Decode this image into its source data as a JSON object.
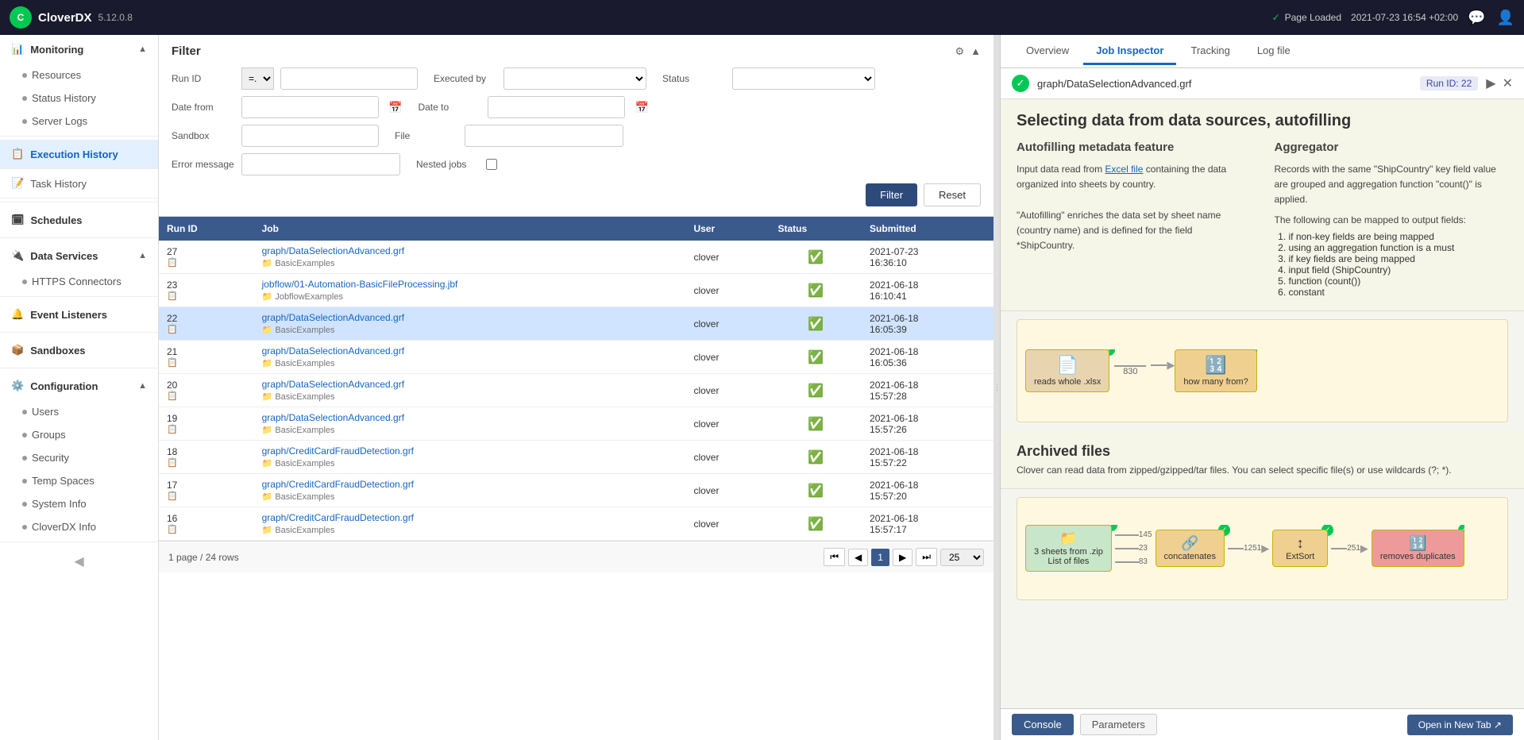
{
  "topnav": {
    "logo_text": "C",
    "brand": "CloverDX",
    "version": "5.12.0.8",
    "status_label": "Page Loaded",
    "timestamp": "2021-07-23 16:54 +02:00"
  },
  "sidebar": {
    "monitoring_label": "Monitoring",
    "items_monitoring": [
      {
        "id": "resources",
        "label": "Resources"
      },
      {
        "id": "status-history",
        "label": "Status History"
      },
      {
        "id": "server-logs",
        "label": "Server Logs"
      }
    ],
    "execution_history_label": "Execution History",
    "task_history_label": "Task History",
    "schedules_label": "Schedules",
    "data_services_label": "Data Services",
    "items_data_services": [
      {
        "id": "https-connectors",
        "label": "HTTPS Connectors"
      }
    ],
    "event_listeners_label": "Event Listeners",
    "sandboxes_label": "Sandboxes",
    "configuration_label": "Configuration",
    "items_configuration": [
      {
        "id": "users",
        "label": "Users"
      },
      {
        "id": "groups",
        "label": "Groups"
      },
      {
        "id": "security",
        "label": "Security"
      },
      {
        "id": "temp-spaces",
        "label": "Temp Spaces"
      },
      {
        "id": "system-info",
        "label": "System Info"
      },
      {
        "id": "cloverdx-info",
        "label": "CloverDX Info"
      }
    ]
  },
  "filter": {
    "title": "Filter",
    "run_id_label": "Run ID",
    "run_id_operator": "=.",
    "executed_by_label": "Executed by",
    "executed_by_placeholder": "",
    "status_label": "Status",
    "status_placeholder": "",
    "date_from_label": "Date from",
    "date_to_label": "Date to",
    "sandbox_label": "Sandbox",
    "file_label": "File",
    "error_message_label": "Error message",
    "nested_jobs_label": "Nested jobs",
    "filter_button": "Filter",
    "reset_button": "Reset"
  },
  "table": {
    "columns": [
      "Run ID",
      "Job",
      "User",
      "Status",
      "Submitted"
    ],
    "rows": [
      {
        "run_id": "27",
        "job": "graph/DataSelectionAdvanced.grf",
        "folder": "BasicExamples",
        "user": "clover",
        "status": "ok",
        "submitted": "2021-07-23\n16:36:10"
      },
      {
        "run_id": "23",
        "job": "jobflow/01-Automation-BasicFileProcessing.jbf",
        "folder": "JobflowExamples",
        "user": "clover",
        "status": "ok",
        "submitted": "2021-06-18\n16:10:41"
      },
      {
        "run_id": "22",
        "job": "graph/DataSelectionAdvanced.grf",
        "folder": "BasicExamples",
        "user": "clover",
        "status": "ok",
        "submitted": "2021-06-18\n16:05:39",
        "selected": true
      },
      {
        "run_id": "21",
        "job": "graph/DataSelectionAdvanced.grf",
        "folder": "BasicExamples",
        "user": "clover",
        "status": "ok",
        "submitted": "2021-06-18\n16:05:36"
      },
      {
        "run_id": "20",
        "job": "graph/DataSelectionAdvanced.grf",
        "folder": "BasicExamples",
        "user": "clover",
        "status": "ok",
        "submitted": "2021-06-18\n15:57:28"
      },
      {
        "run_id": "19",
        "job": "graph/DataSelectionAdvanced.grf",
        "folder": "BasicExamples",
        "user": "clover",
        "status": "ok",
        "submitted": "2021-06-18\n15:57:26"
      },
      {
        "run_id": "18",
        "job": "graph/CreditCardFraudDetection.grf",
        "folder": "BasicExamples",
        "user": "clover",
        "status": "ok",
        "submitted": "2021-06-18\n15:57:22"
      },
      {
        "run_id": "17",
        "job": "graph/CreditCardFraudDetection.grf",
        "folder": "BasicExamples",
        "user": "clover",
        "status": "ok",
        "submitted": "2021-06-18\n15:57:20"
      },
      {
        "run_id": "16",
        "job": "graph/CreditCardFraudDetection.grf",
        "folder": "BasicExamples",
        "user": "clover",
        "status": "ok",
        "submitted": "2021-06-18\n15:57:17"
      }
    ],
    "footer": {
      "page_info": "1 page / 24 rows",
      "current_page": "1",
      "per_page": "25"
    }
  },
  "right_panel": {
    "tabs": [
      "Overview",
      "Job Inspector",
      "Tracking",
      "Log file"
    ],
    "active_tab": "Job Inspector",
    "job_name": "graph/DataSelectionAdvanced.grf",
    "run_id_badge": "Run ID: 22",
    "sections": {
      "autofilling_title": "Selecting data from data sources, autofilling",
      "feature_title": "Autofilling metadata feature",
      "feature_text1": "Input data read from",
      "feature_link": "Excel file",
      "feature_text2": "containing the data organized into sheets by country.",
      "feature_text3": "\"Autofilling\" enriches the data set by sheet name (country name) and is defined for the field *ShipCountry.",
      "aggregator_title": "Aggregator",
      "aggregator_text": "Records with the same \"ShipCountry\" key field value are grouped and aggregation function \"count()\" is applied.",
      "aggregator_list_title": "The following can be mapped to output fields:",
      "aggregator_items": [
        "if non-key fields are being mapped",
        "using an aggregation function is a must",
        "if key fields are being mapped",
        "input field (ShipCountry)",
        "function (count())",
        "constant"
      ],
      "graph_node1": "reads whole .xlsx",
      "graph_node2": "how many from?",
      "graph_number": "830",
      "archived_title": "Archived files",
      "archived_text": "Clover can read data from zipped/gzipped/tar files. You can select specific file(s) or use wildcards (?; *).",
      "archived_node1": "3 sheets from .zip\nList of files",
      "archived_numbers": [
        "145",
        "23",
        "83"
      ],
      "archived_node2": "concatenates",
      "archived_node3": "ExtSort",
      "archived_node4": "removes duplicates",
      "archived_flow_numbers": [
        "1251",
        "251"
      ]
    },
    "footer": {
      "console_label": "Console",
      "parameters_label": "Parameters",
      "open_new_tab": "Open in New Tab ↗"
    }
  }
}
